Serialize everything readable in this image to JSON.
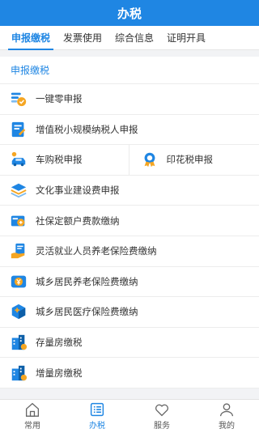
{
  "header": {
    "title": "办税"
  },
  "tabs": [
    {
      "label": "申报缴税"
    },
    {
      "label": "发票使用"
    },
    {
      "label": "综合信息"
    },
    {
      "label": "证明开具"
    }
  ],
  "section": {
    "title": "申报缴税"
  },
  "items": [
    {
      "label": "一键零申报",
      "icon": "zero-declare-icon"
    },
    {
      "label": "增值税小规模纳税人申报",
      "icon": "vat-form-icon"
    },
    {
      "label": "车购税申报",
      "icon": "car-icon"
    },
    {
      "label": "印花税申报",
      "icon": "stamp-icon"
    },
    {
      "label": "文化事业建设费申报",
      "icon": "layers-icon"
    },
    {
      "label": "社保定额户费款缴纳",
      "icon": "social-card-icon"
    },
    {
      "label": "灵活就业人员养老保险费缴纳",
      "icon": "hand-document-icon"
    },
    {
      "label": "城乡居民养老保险费缴纳",
      "icon": "pension-icon"
    },
    {
      "label": "城乡居民医疗保险费缴纳",
      "icon": "medical-box-icon"
    },
    {
      "label": "存量房缴税",
      "icon": "building-icon"
    },
    {
      "label": "增量房缴税",
      "icon": "building-icon"
    }
  ],
  "nav": [
    {
      "label": "常用",
      "icon": "home-icon"
    },
    {
      "label": "办税",
      "icon": "list-icon"
    },
    {
      "label": "服务",
      "icon": "heart-icon"
    },
    {
      "label": "我的",
      "icon": "user-icon"
    }
  ],
  "colors": {
    "primary": "#1f86e3",
    "accent_orange": "#f5a623"
  }
}
